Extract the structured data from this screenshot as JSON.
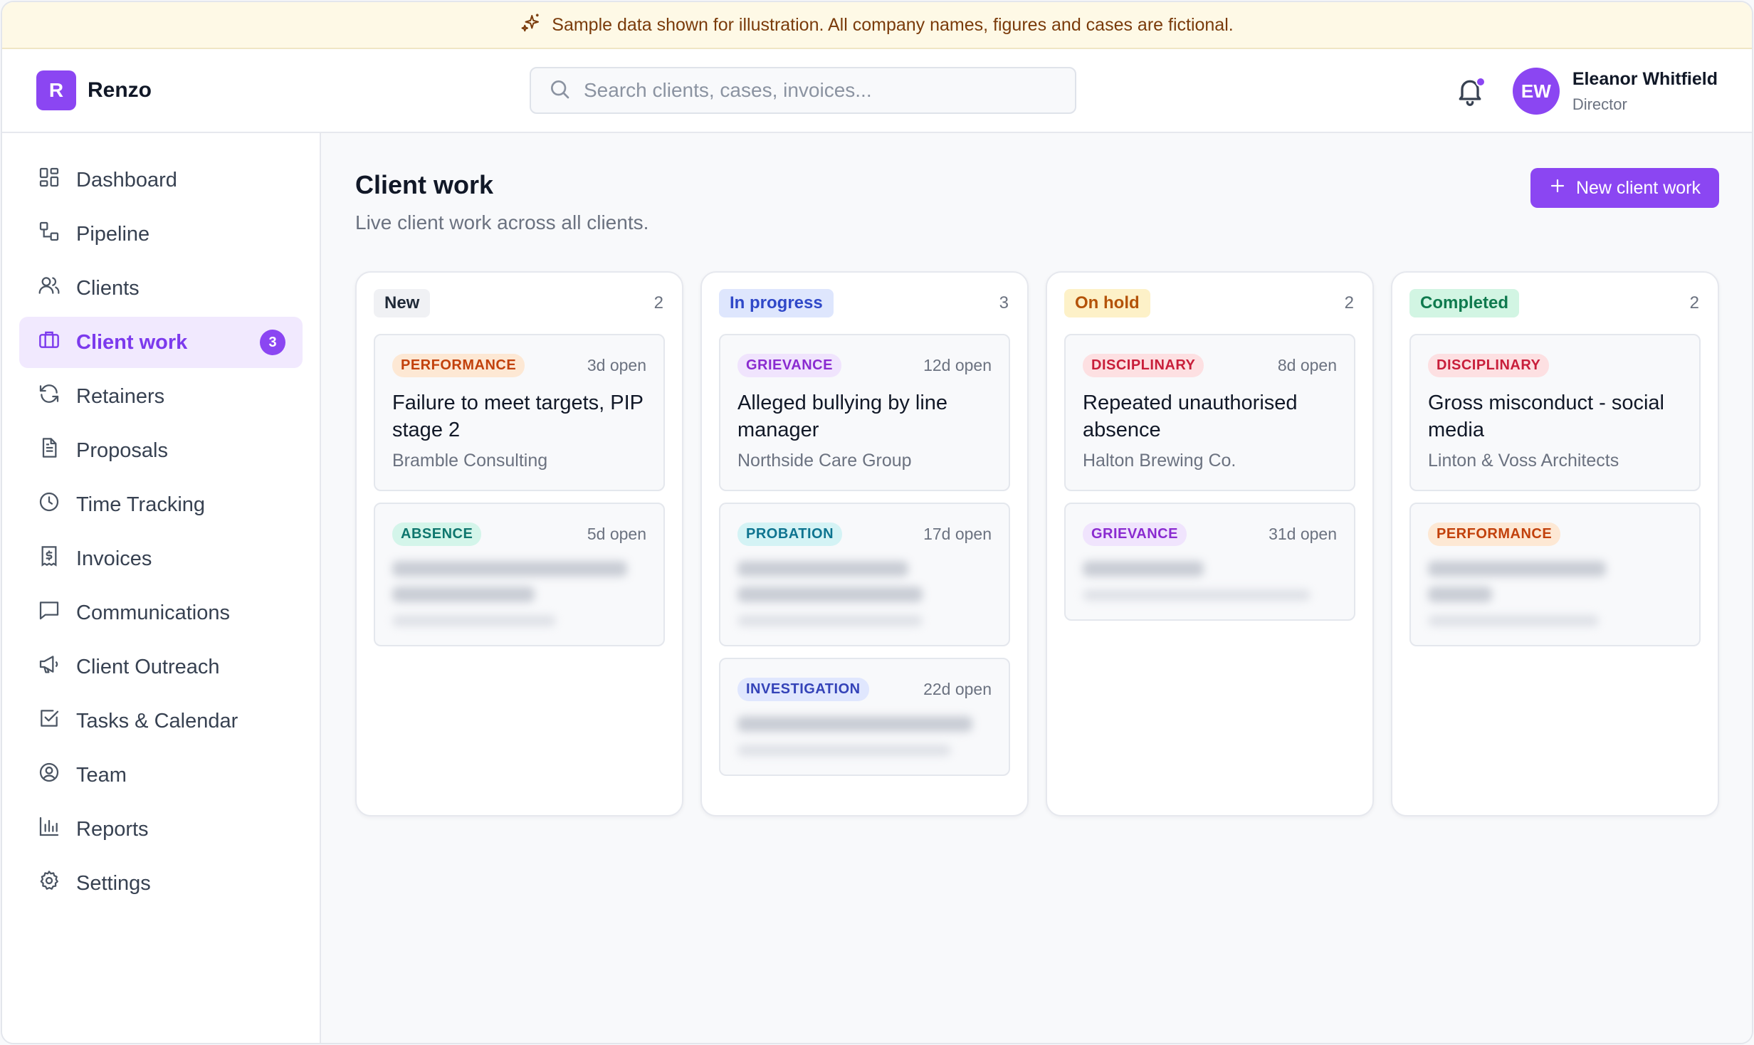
{
  "banner": {
    "text": "Sample data shown for illustration. All company names, figures and cases are fictional.",
    "icon": "sparkle-icon"
  },
  "header": {
    "brand_letter": "R",
    "brand_name": "Renzo",
    "search_placeholder": "Search clients, cases, invoices...",
    "user": {
      "initials": "EW",
      "name": "Eleanor Whitfield",
      "role": "Director"
    }
  },
  "sidebar": {
    "items": [
      {
        "label": "Dashboard",
        "icon": "dashboard-icon"
      },
      {
        "label": "Pipeline",
        "icon": "pipeline-icon"
      },
      {
        "label": "Clients",
        "icon": "users-icon"
      },
      {
        "label": "Client work",
        "icon": "briefcase-icon",
        "active": true,
        "badge": "3"
      },
      {
        "label": "Retainers",
        "icon": "refresh-icon"
      },
      {
        "label": "Proposals",
        "icon": "document-icon"
      },
      {
        "label": "Time Tracking",
        "icon": "clock-icon"
      },
      {
        "label": "Invoices",
        "icon": "invoice-icon"
      },
      {
        "label": "Communications",
        "icon": "chat-icon"
      },
      {
        "label": "Client Outreach",
        "icon": "megaphone-icon"
      },
      {
        "label": "Tasks & Calendar",
        "icon": "checkbox-icon"
      },
      {
        "label": "Team",
        "icon": "user-circle-icon"
      },
      {
        "label": "Reports",
        "icon": "bar-chart-icon"
      },
      {
        "label": "Settings",
        "icon": "gear-icon"
      }
    ]
  },
  "main": {
    "title": "Client work",
    "subtitle": "Live client work across all clients.",
    "new_button": "New client work",
    "columns": [
      {
        "label": "New",
        "count": "2",
        "cards": [
          {
            "tag": "PERFORMANCE",
            "open": "3d open",
            "title": "Failure to meet targets, PIP stage 2",
            "client": "Bramble Consulting"
          },
          {
            "tag": "ABSENCE",
            "open": "5d open",
            "title": "",
            "client": ""
          }
        ]
      },
      {
        "label": "In progress",
        "count": "3",
        "cards": [
          {
            "tag": "GRIEVANCE",
            "open": "12d open",
            "title": "Alleged bullying by line manager",
            "client": "Northside Care Group"
          },
          {
            "tag": "PROBATION",
            "open": "17d open",
            "title": "",
            "client": ""
          },
          {
            "tag": "INVESTIGATION",
            "open": "22d open",
            "title": "",
            "client": ""
          }
        ]
      },
      {
        "label": "On hold",
        "count": "2",
        "cards": [
          {
            "tag": "DISCIPLINARY",
            "open": "8d open",
            "title": "Repeated unauthorised absence",
            "client": "Halton Brewing Co."
          },
          {
            "tag": "GRIEVANCE",
            "open": "31d open",
            "title": "",
            "client": ""
          }
        ]
      },
      {
        "label": "Completed",
        "count": "2",
        "cards": [
          {
            "tag": "DISCIPLINARY",
            "open": "",
            "title": "Gross misconduct - social media",
            "client": "Linton & Voss Architects"
          },
          {
            "tag": "PERFORMANCE",
            "open": "",
            "title": "",
            "client": ""
          }
        ]
      }
    ]
  },
  "colors": {
    "accent": "#8b46f2",
    "banner_bg": "#fef9e6",
    "banner_text": "#7a3b0b"
  }
}
